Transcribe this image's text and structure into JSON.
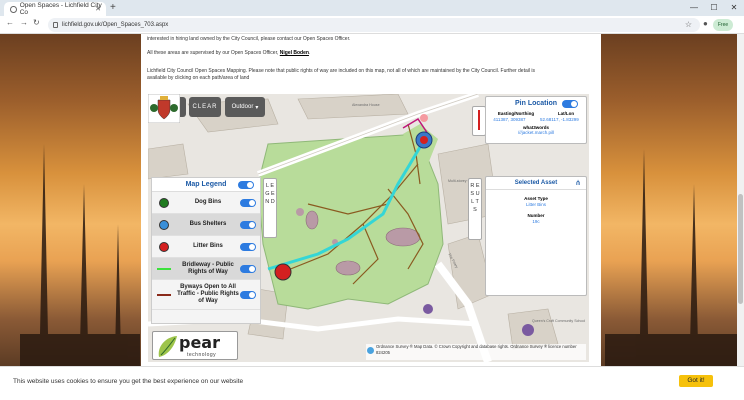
{
  "browser": {
    "tab_title": "Open Spaces - Lichfield City Co",
    "url": "lichfield.gov.uk/Open_Spaces_703.aspx",
    "free_label": "Free"
  },
  "page": {
    "intro_line": "interested in hiring land owned by the City Council, please contact our Open Spaces Officer.",
    "supervised_prefix": "All these areas are supervised by our Open Spaces Officer,",
    "officer_name": "Nigel Boden",
    "mapping_line1": "Lichfield City Council Open Spaces Mapping. Please note that public rights of way are included on this map, not all of which are maintained by the City Council. Further detail is",
    "mapping_line2": "available by clicking on each path/area of land"
  },
  "map": {
    "controls": {
      "zoom_in": "+",
      "zoom_out": "−",
      "clear": "CLEAR",
      "layer": "Outdoor"
    },
    "legend": {
      "title": "Map Legend",
      "tab_label": "L E G E N D",
      "items": [
        {
          "label": "Dog Bins",
          "color": "#1f7a1f"
        },
        {
          "label": "Bus Shelters",
          "color": "#3a8fd8"
        },
        {
          "label": "Litter Bins",
          "color": "#d42020"
        },
        {
          "label": "Bridleway - Public Rights of Way",
          "color": "#3ce13c"
        },
        {
          "label": "Byways Open to All Traffic - Public Rights of Way",
          "color": "#8a2a1a"
        }
      ]
    },
    "pin_location": {
      "title": "Pin Location",
      "easting_label": "Easting/Northing",
      "latlon_label": "Lat/Lon",
      "easting_value": "411387, 309387",
      "latlon_value": "52.68117, -1.83299",
      "w3w_label": "what3words",
      "w3w_value": "///jacket.march.pill"
    },
    "results_tab": "R E S U L T S",
    "selected_asset": {
      "title": "Selected Asset",
      "type_label": "Asset Type",
      "type_value": "Litter Bins",
      "number_label": "Number",
      "number_value": "19c"
    },
    "logo": {
      "word": "pear",
      "sub": "technology"
    },
    "labels": {
      "hospital": "Alexandra House",
      "car_park": "Multi-storey Car Park",
      "community": "Queen's Croft Community School",
      "road": "The Friary"
    },
    "attribution": "Ordnance Survey ® Map Data. © Crown Copyright and database rights. Ordnance Survey ® licence number 824205"
  },
  "cookie": {
    "message": "This website uses cookies to ensure you get the best experience on our website",
    "button": "Got it!"
  }
}
